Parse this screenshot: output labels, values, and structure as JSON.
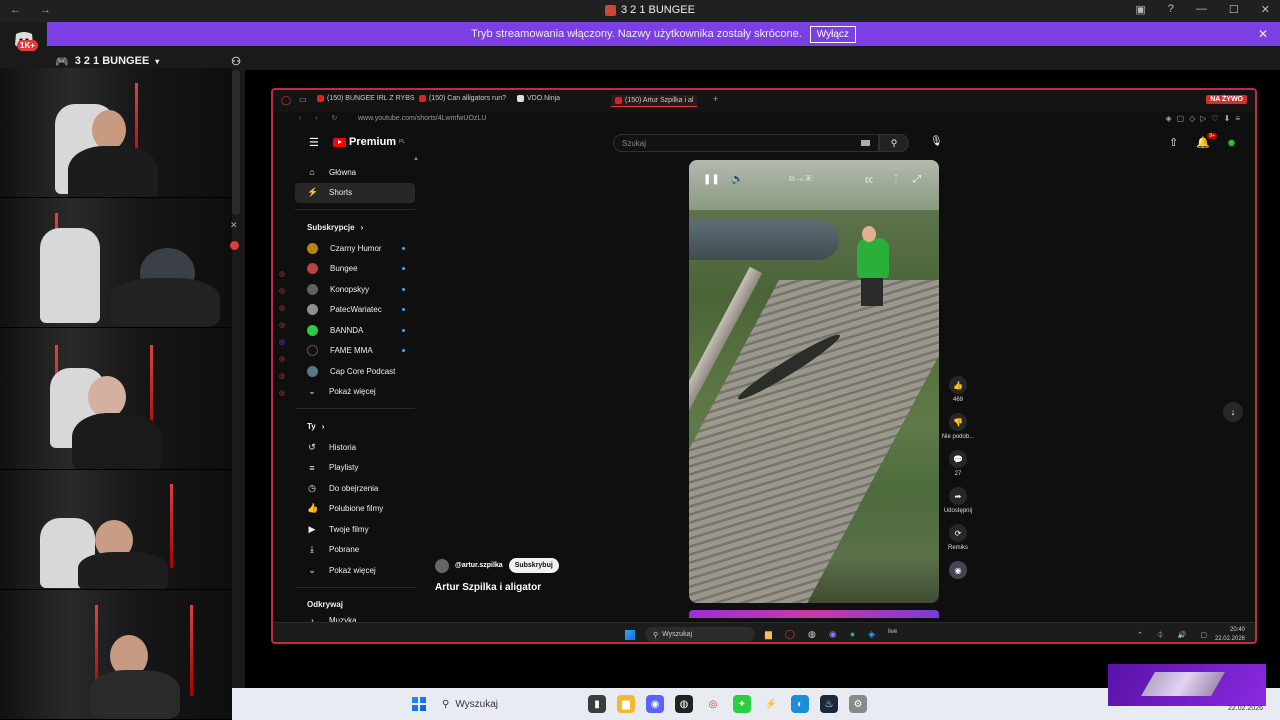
{
  "window": {
    "title": "3 2 1 BUNGEE",
    "controls": [
      "—",
      "☐",
      "✕"
    ]
  },
  "banner": {
    "text": "Tryb streamowania włączony. Nazwy użytkownika zostały skrócone.",
    "button": "Wyłącz"
  },
  "discord": {
    "badge": "1K+",
    "channel": "3 2 1 BUNGEE"
  },
  "browser": {
    "tabs": [
      "(150) BUNGEE IRL Z RYBS",
      "(150) Can alligators run?",
      "VDO.Ninja",
      "(150) Artur Szpilka i al"
    ],
    "live_badge": "NA ŻYWO",
    "url": "www.youtube.com/shorts/4LwmfwUOzLU"
  },
  "youtube": {
    "logo_text": "Premium",
    "logo_sup": "PL",
    "search_placeholder": "Szukaj",
    "notif_count": "9+",
    "nav_main": [
      {
        "label": "Główna",
        "icon": "home-icon",
        "glyph": "⌂"
      },
      {
        "label": "Shorts",
        "icon": "shorts-icon",
        "glyph": "⚡"
      }
    ],
    "subs_header": "Subskrypcje",
    "subs": [
      {
        "label": "Czarny Humor",
        "color": "#b8860b"
      },
      {
        "label": "Bungee",
        "color": "#c04040"
      },
      {
        "label": "Konopskyy",
        "color": "#606060"
      },
      {
        "label": "PatecWariatec",
        "color": "#909090"
      },
      {
        "label": "BANNDA",
        "color": "#2ecc40"
      },
      {
        "label": "FAME MMA",
        "color": "#111111"
      },
      {
        "label": "Cap Core Podcast",
        "color": "#557788"
      }
    ],
    "show_more": "Pokaż więcej",
    "you_header": "Ty",
    "you_items": [
      {
        "label": "Historia",
        "glyph": "↺"
      },
      {
        "label": "Playlisty",
        "glyph": "≡"
      },
      {
        "label": "Do obejrzenia",
        "glyph": "◷"
      },
      {
        "label": "Polubione filmy",
        "glyph": "👍"
      },
      {
        "label": "Twoje filmy",
        "glyph": "▶"
      },
      {
        "label": "Pobrane",
        "glyph": "⤓"
      }
    ],
    "show_more2": "Pokaż więcej",
    "explore_header": "Odkrywaj",
    "explore_first": "Muzyka",
    "short": {
      "channel": "@artur.szpilka",
      "subscribe": "Subskrybuj",
      "title": "Artur Szpilka i aligator",
      "likes": "469",
      "dislike_label": "Nie podob...",
      "comments": "27",
      "share_label": "Udostępnij",
      "remix_label": "Remiks"
    }
  },
  "inner_taskbar": {
    "search": "Wyszukaj",
    "time": "20:40",
    "date": "22.02.2026"
  },
  "outer_taskbar": {
    "search": "Wyszukaj",
    "date": "22.02.2026"
  }
}
